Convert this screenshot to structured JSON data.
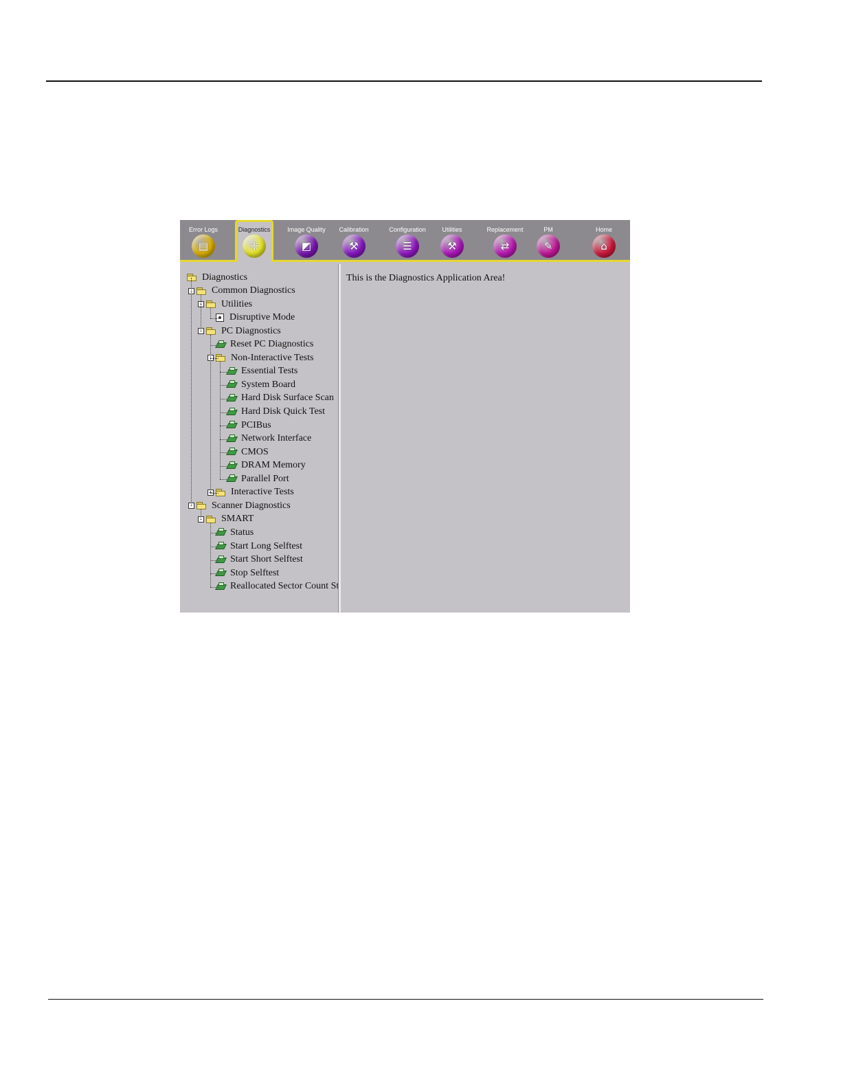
{
  "toolbar": {
    "tabs": [
      {
        "label": "Error Logs",
        "icon": "error-logs-icon",
        "color": "#e2b400",
        "glyph": "▤"
      },
      {
        "label": "Diagnostics",
        "icon": "diagnostics-icon",
        "color": "#e9e62a",
        "glyph": "❈",
        "active": true
      },
      {
        "label": "Image Quality",
        "icon": "image-quality-icon",
        "color": "#7c16b8",
        "glyph": "◩"
      },
      {
        "label": "Calibration",
        "icon": "calibration-icon",
        "color": "#8a18c8",
        "glyph": "⚒"
      },
      {
        "label": "Configuration",
        "icon": "configuration-icon",
        "color": "#9518c8",
        "glyph": "☰"
      },
      {
        "label": "Utilities",
        "icon": "utilities-icon",
        "color": "#b018c0",
        "glyph": "⚒"
      },
      {
        "label": "Replacement",
        "icon": "replacement-icon",
        "color": "#c018b8",
        "glyph": "⇄"
      },
      {
        "label": "PM",
        "icon": "pm-icon",
        "color": "#c8189e",
        "glyph": "✎"
      },
      {
        "label": "Home",
        "icon": "home-icon",
        "color": "#d4183c",
        "glyph": "⌂"
      }
    ]
  },
  "tree": [
    {
      "label": "Diagnostics",
      "kind": "folder",
      "depth": 0,
      "expander": ""
    },
    {
      "label": "Common Diagnostics",
      "kind": "folder",
      "depth": 1,
      "expander": "-"
    },
    {
      "label": "Utilities",
      "kind": "folder",
      "depth": 2,
      "expander": "-"
    },
    {
      "label": "Disruptive Mode",
      "kind": "setting",
      "depth": 3,
      "expander": ""
    },
    {
      "label": "PC Diagnostics",
      "kind": "folder",
      "depth": 2,
      "expander": "-"
    },
    {
      "label": "Reset PC Diagnostics",
      "kind": "test",
      "depth": 3,
      "expander": ""
    },
    {
      "label": "Non-Interactive Tests",
      "kind": "folder",
      "depth": 3,
      "expander": "-"
    },
    {
      "label": "Essential Tests",
      "kind": "test",
      "depth": 4,
      "expander": ""
    },
    {
      "label": "System Board",
      "kind": "test",
      "depth": 4,
      "expander": ""
    },
    {
      "label": "Hard Disk Surface Scan",
      "kind": "test",
      "depth": 4,
      "expander": ""
    },
    {
      "label": "Hard Disk Quick Test",
      "kind": "test",
      "depth": 4,
      "expander": ""
    },
    {
      "label": "PCIBus",
      "kind": "test",
      "depth": 4,
      "expander": ""
    },
    {
      "label": "Network Interface",
      "kind": "test",
      "depth": 4,
      "expander": ""
    },
    {
      "label": "CMOS",
      "kind": "test",
      "depth": 4,
      "expander": ""
    },
    {
      "label": "DRAM Memory",
      "kind": "test",
      "depth": 4,
      "expander": ""
    },
    {
      "label": "Parallel Port",
      "kind": "test",
      "depth": 4,
      "expander": ""
    },
    {
      "label": "Interactive Tests",
      "kind": "folder",
      "depth": 3,
      "expander": "+"
    },
    {
      "label": "Scanner Diagnostics",
      "kind": "folder",
      "depth": 1,
      "expander": "-"
    },
    {
      "label": "SMART",
      "kind": "folder",
      "depth": 2,
      "expander": "-"
    },
    {
      "label": "Status",
      "kind": "test",
      "depth": 3,
      "expander": ""
    },
    {
      "label": "Start Long Selftest",
      "kind": "test",
      "depth": 3,
      "expander": ""
    },
    {
      "label": "Start Short Selftest",
      "kind": "test",
      "depth": 3,
      "expander": ""
    },
    {
      "label": "Stop Selftest",
      "kind": "test",
      "depth": 3,
      "expander": ""
    },
    {
      "label": "Reallocated Sector Count St",
      "kind": "test",
      "depth": 3,
      "expander": ""
    }
  ],
  "app_area": {
    "message": "This is the Diagnostics Application Area!"
  }
}
